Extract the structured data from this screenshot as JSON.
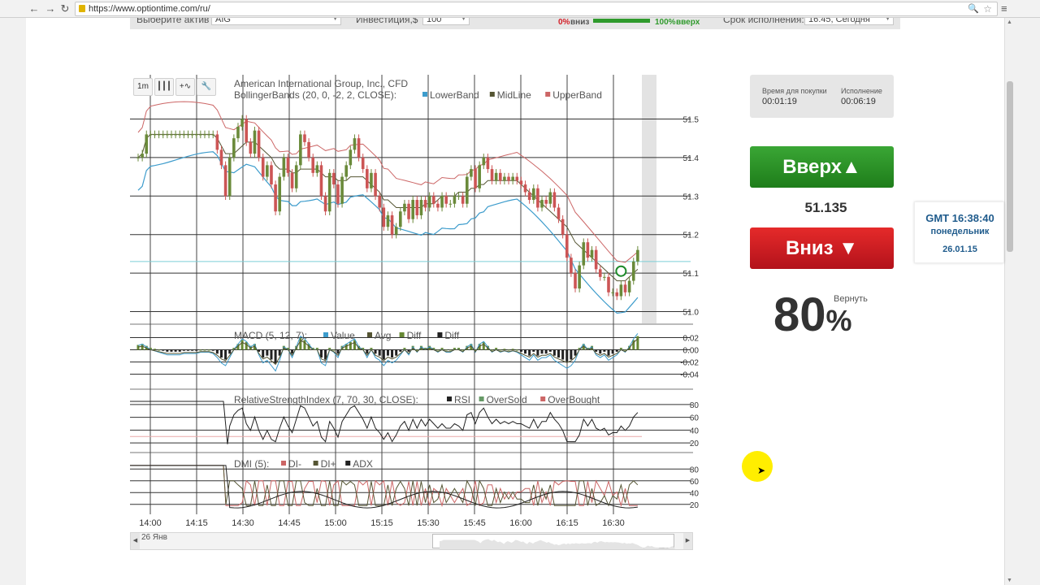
{
  "browser": {
    "url": "https://www.optiontime.com/ru/",
    "back_icon": "←",
    "forward_icon": "→",
    "reload_icon": "↻",
    "star_icon": "☆",
    "menu_icon": "≡",
    "zoom_icon": "🔍"
  },
  "topform": {
    "asset_label": "Выберите актив",
    "asset_value": "AIG",
    "investment_label": "Инвестиция,$",
    "investment_value": "100",
    "down_pct": "0%",
    "down_label": "вниз",
    "up_pct": "100%",
    "up_label": "вверх",
    "expiry_label": "Срок исполнения:",
    "expiry_value": "16:45, Сегодня"
  },
  "toolbar": {
    "timeframe": "1m"
  },
  "chart_data": {
    "type": "candlestick",
    "title": "American International Group, Inc., CFD",
    "price_pane": {
      "indicator": "BollingerBands (20, 0, -2, 2, CLOSE):",
      "legend": [
        {
          "name": "LowerBand",
          "color": "#3d9ccc"
        },
        {
          "name": "MidLine",
          "color": "#555533"
        },
        {
          "name": "UpperBand",
          "color": "#cc6666"
        }
      ],
      "y_ticks": [
        "51.5",
        "51.4",
        "51.3",
        "51.2",
        "51.1",
        "51.0"
      ],
      "y_range": [
        50.98,
        51.56
      ],
      "current_price_line": 51.13,
      "closes": [
        51.4,
        51.41,
        51.46,
        51.46,
        51.46,
        51.46,
        51.46,
        51.46,
        51.46,
        51.46,
        51.46,
        51.46,
        51.46,
        51.46,
        51.46,
        51.46,
        51.46,
        51.46,
        51.46,
        51.42,
        51.38,
        51.3,
        51.4,
        51.45,
        51.48,
        51.5,
        51.44,
        51.41,
        51.47,
        51.4,
        51.35,
        51.38,
        51.33,
        51.26,
        51.35,
        51.4,
        51.36,
        51.32,
        51.38,
        51.46,
        51.44,
        51.4,
        51.36,
        51.38,
        51.3,
        51.26,
        51.36,
        51.33,
        51.28,
        51.35,
        51.38,
        51.42,
        51.45,
        51.4,
        51.37,
        51.32,
        51.36,
        51.3,
        51.27,
        51.22,
        51.25,
        51.2,
        51.22,
        51.26,
        51.28,
        51.24,
        51.29,
        51.25,
        51.29,
        51.27,
        51.3,
        51.28,
        51.27,
        51.3,
        51.28,
        51.28,
        51.3,
        51.3,
        51.28,
        51.35,
        51.37,
        51.32,
        51.38,
        51.4,
        51.37,
        51.34,
        51.36,
        51.34,
        51.35,
        51.34,
        51.35,
        51.34,
        51.33,
        51.31,
        51.29,
        51.32,
        51.27,
        51.29,
        51.28,
        51.31,
        51.27,
        51.24,
        51.2,
        51.14,
        51.1,
        51.06,
        51.12,
        51.18,
        51.14,
        51.16,
        51.11,
        51.09,
        51.09,
        51.05,
        51.05,
        51.04,
        51.07,
        51.05,
        51.08,
        51.13,
        51.16
      ],
      "midline": [
        51.4,
        51.41,
        51.45,
        51.46,
        51.46,
        51.46,
        51.46,
        51.46,
        51.46,
        51.46,
        51.46,
        51.46,
        51.46,
        51.46,
        51.46,
        51.46,
        51.46,
        51.46,
        51.46,
        51.45,
        51.43,
        51.41,
        51.41,
        51.41,
        51.42,
        51.43,
        51.44,
        51.44,
        51.44,
        51.43,
        51.42,
        51.41,
        51.4,
        51.38,
        51.37,
        51.37,
        51.37,
        51.36,
        51.36,
        51.37,
        51.37,
        51.37,
        51.37,
        51.37,
        51.36,
        51.35,
        51.35,
        51.35,
        51.34,
        51.34,
        51.34,
        51.35,
        51.35,
        51.35,
        51.35,
        51.34,
        51.33,
        51.32,
        51.31,
        51.29,
        51.29,
        51.28,
        51.27,
        51.27,
        51.27,
        51.27,
        51.27,
        51.27,
        51.27,
        51.28,
        51.28,
        51.28,
        51.29,
        51.3,
        51.3,
        51.3,
        51.3,
        51.31,
        51.31,
        51.31,
        51.32,
        51.32,
        51.33,
        51.33,
        51.34,
        51.34,
        51.34,
        51.34,
        51.34,
        51.34,
        51.34,
        51.34,
        51.33,
        51.32,
        51.31,
        51.3,
        51.29,
        51.28,
        51.27,
        51.26,
        51.25,
        51.24,
        51.23,
        51.22,
        51.2,
        51.18,
        51.17,
        51.16,
        51.15,
        51.14,
        51.13,
        51.12,
        51.11,
        51.1,
        51.09,
        51.08,
        51.08,
        51.08,
        51.09,
        51.1,
        51.11
      ]
    },
    "macd_pane": {
      "indicator": "MACD (5, 12, 7):",
      "legend": [
        {
          "name": "Value",
          "color": "#3d9ccc"
        },
        {
          "name": "Avg",
          "color": "#555533"
        },
        {
          "name": "Diff",
          "color": "#668833"
        },
        {
          "name": "Diff",
          "color": "#222222"
        }
      ],
      "y_ticks": [
        "0.02",
        "0.00",
        "-0.02",
        "-0.04"
      ],
      "y_range": [
        -0.05,
        0.03
      ],
      "histogram": [
        0.005,
        0.006,
        0.004,
        0.002,
        0.001,
        0,
        -0.001,
        -0.002,
        -0.002,
        -0.002,
        -0.002,
        -0.001,
        -0.001,
        -0.001,
        -0.001,
        0,
        0,
        0,
        -0.001,
        -0.004,
        -0.008,
        -0.01,
        -0.004,
        0.002,
        0.006,
        0.01,
        0.008,
        0.004,
        0.006,
        -0.002,
        -0.008,
        -0.006,
        -0.01,
        -0.014,
        -0.006,
        0.004,
        0.002,
        -0.004,
        0.004,
        0.012,
        0.01,
        0.006,
        0.002,
        0.002,
        -0.008,
        -0.01,
        0.002,
        0,
        -0.004,
        0.004,
        0.006,
        0.008,
        0.01,
        0.004,
        0.002,
        -0.004,
        0.002,
        -0.004,
        -0.006,
        -0.01,
        -0.006,
        -0.008,
        -0.006,
        -0.002,
        0.002,
        -0.002,
        0.004,
        0,
        0.004,
        0.002,
        0.004,
        0.002,
        0,
        0.002,
        0,
        0,
        0.002,
        0.002,
        0,
        0.004,
        0.006,
        0,
        0.006,
        0.008,
        0.004,
        0,
        0.002,
        0,
        0.001,
        0,
        0.001,
        0,
        -0.002,
        -0.004,
        -0.006,
        -0.002,
        -0.006,
        -0.004,
        -0.004,
        -0.002,
        -0.006,
        -0.008,
        -0.01,
        -0.012,
        -0.01,
        -0.006,
        0.002,
        0.006,
        0.002,
        0.004,
        -0.002,
        -0.004,
        -0.002,
        -0.006,
        -0.004,
        -0.002,
        0.002,
        0,
        0.004,
        0.01,
        0.014
      ]
    },
    "rsi_pane": {
      "indicator": "RelativeStrengthIndex (7, 70, 30, CLOSE):",
      "legend": [
        {
          "name": "RSI",
          "color": "#222222"
        },
        {
          "name": "OverSold",
          "color": "#669966"
        },
        {
          "name": "OverBought",
          "color": "#cc6666"
        }
      ],
      "y_ticks": [
        "80",
        "60",
        "40",
        "20"
      ],
      "y_range": [
        10,
        90
      ]
    },
    "dmi_pane": {
      "indicator": "DMI (5):",
      "legend": [
        {
          "name": "DI-",
          "color": "#cc6666"
        },
        {
          "name": "DI+",
          "color": "#555533"
        },
        {
          "name": "ADX",
          "color": "#222222"
        }
      ],
      "y_ticks": [
        "80",
        "60",
        "40",
        "20"
      ],
      "y_range": [
        10,
        90
      ]
    },
    "x_ticks": [
      "14:00",
      "14:15",
      "14:30",
      "14:45",
      "15:00",
      "15:15",
      "15:30",
      "15:45",
      "16:00",
      "16:15",
      "16:30"
    ]
  },
  "navigator": {
    "date_label": "26 Янв"
  },
  "timer": {
    "buy_time_label": "Время для покупки",
    "buy_time_value": "00:01:19",
    "expiry_label": "Исполнение",
    "expiry_value": "00:06:19"
  },
  "trade": {
    "up_label": "Вверх▲",
    "price": "51.135",
    "down_label": "Вниз ▼",
    "return_label": "Вернуть",
    "payout": "80",
    "payout_unit": "%"
  },
  "clock": {
    "time": "GMT 16:38:40",
    "weekday": "понедельник",
    "date": "26.01.15"
  },
  "colors": {
    "up": "#2f9a2c",
    "down": "#d31d25",
    "candle_up": "#6a8a3a",
    "candle_down": "#cc5555",
    "grid": "#000000"
  }
}
